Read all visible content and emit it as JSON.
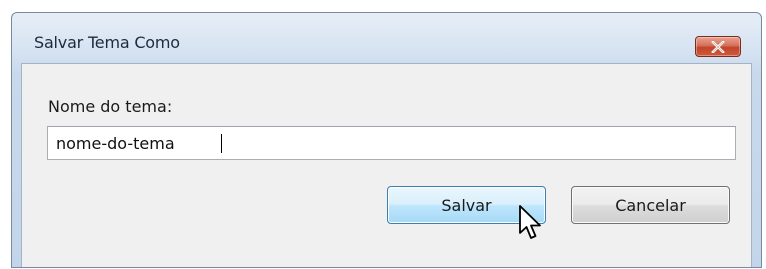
{
  "dialog": {
    "title": "Salvar Tema Como",
    "close_icon": "close-x-icon",
    "accent_close": "#c94b30"
  },
  "form": {
    "label": "Nome do tema:",
    "input_value": "nome-do-tema"
  },
  "buttons": {
    "save_label": "Salvar",
    "cancel_label": "Cancelar"
  },
  "cursor": {
    "icon": "mouse-pointer-icon"
  }
}
